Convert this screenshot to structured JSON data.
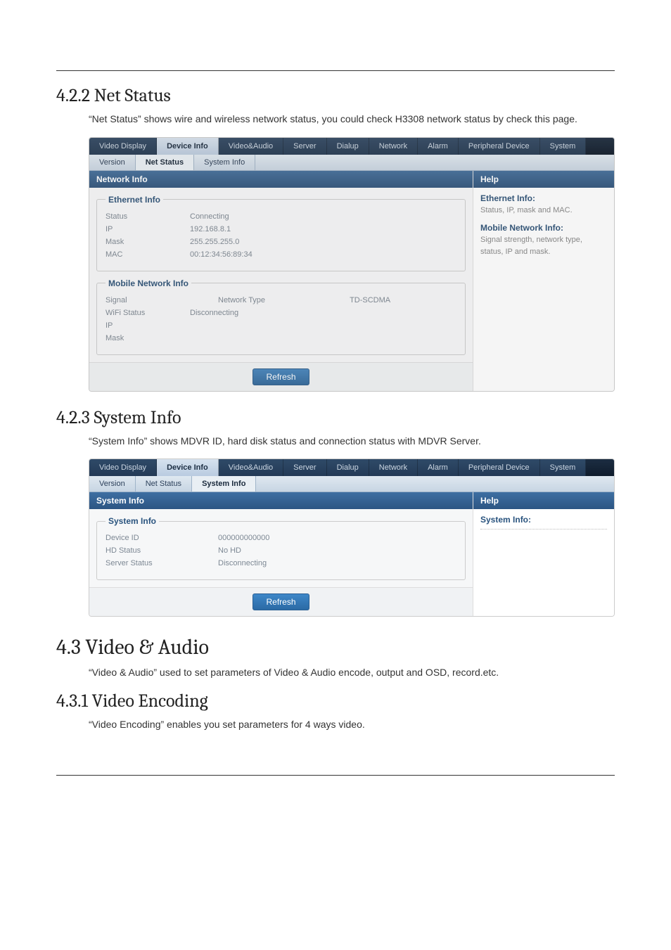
{
  "sections": {
    "s1_heading": "4.2.2 Net Status",
    "s1_para": "“Net Status” shows wire and wireless network status, you could check H3308 network status by check this page.",
    "s2_heading": "4.2.3 System Info",
    "s2_para": "“System Info” shows MDVR ID, hard disk status and connection status with MDVR Server.",
    "s3_heading": "4.3 Video & Audio",
    "s3_para": "“Video & Audio” used to set parameters of Video & Audio encode, output and OSD, record.etc.",
    "s4_heading": "4.3.1 Video Encoding",
    "s4_para": "“Video Encoding” enables you set parameters for 4 ways video."
  },
  "shot1": {
    "main_tabs": {
      "video_display": "Video Display",
      "device_info": "Device Info",
      "video_audio": "Video&Audio",
      "server": "Server",
      "dialup": "Dialup",
      "network": "Network",
      "alarm": "Alarm",
      "peripheral": "Peripheral Device",
      "system": "System"
    },
    "sub_tabs": {
      "version": "Version",
      "net_status": "Net Status",
      "system_info": "System Info"
    },
    "panel_title": "Network Info",
    "ethernet": {
      "legend": "Ethernet Info",
      "status_label": "Status",
      "status_value": "Connecting",
      "ip_label": "IP",
      "ip_value": "192.168.8.1",
      "mask_label": "Mask",
      "mask_value": "255.255.255.0",
      "mac_label": "MAC",
      "mac_value": "00:12:34:56:89:34"
    },
    "mobile": {
      "legend": "Mobile Network Info",
      "signal_label": "Signal",
      "nettype_label": "Network Type",
      "nettype_value": "TD-SCDMA",
      "wifi_label": "WiFi Status",
      "wifi_value": "Disconnecting",
      "ip_label": "IP",
      "mask_label": "Mask"
    },
    "refresh": "Refresh",
    "help": {
      "title": "Help",
      "eth_title": "Ethernet Info:",
      "eth_text": "Status, IP, mask and MAC.",
      "mob_title": "Mobile Network Info:",
      "mob_text": "Signal strength, network type, status, IP and mask."
    }
  },
  "shot2": {
    "main_tabs": {
      "video_display": "Video Display",
      "device_info": "Device Info",
      "video_audio": "Video&Audio",
      "server": "Server",
      "dialup": "Dialup",
      "network": "Network",
      "alarm": "Alarm",
      "peripheral": "Peripheral Device",
      "system": "System"
    },
    "sub_tabs": {
      "version": "Version",
      "net_status": "Net Status",
      "system_info": "System Info"
    },
    "panel_title": "System Info",
    "fields": {
      "legend": "System Info",
      "device_id_label": "Device ID",
      "device_id_value": "000000000000",
      "hd_label": "HD Status",
      "hd_value": "No HD",
      "server_label": "Server Status",
      "server_value": "Disconnecting"
    },
    "refresh": "Refresh",
    "help": {
      "title": "Help",
      "sys_title": "System Info:"
    }
  }
}
